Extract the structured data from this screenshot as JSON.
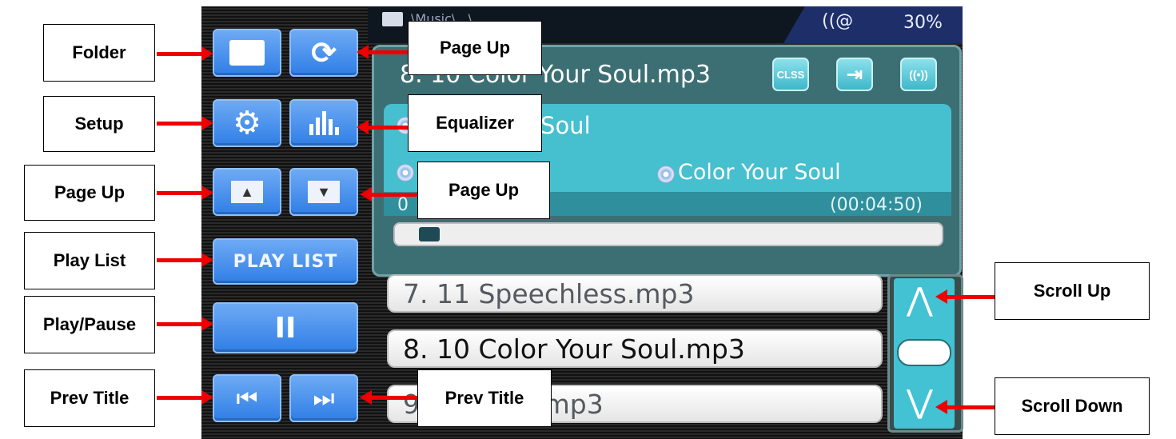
{
  "status": {
    "folder_path": "\\Music\\...\\",
    "signal_icon": "((@",
    "battery": "30%"
  },
  "sidebar": {
    "folder_icon": "folder-icon",
    "repeat_icon": "repeat-icon",
    "setup_icon": "gear-icon",
    "equalizer_icon": "equalizer-icon",
    "page_up_glyph": "▲",
    "page_down_glyph": "▼",
    "play_list_label": "PLAY LIST",
    "pause_glyph": "II",
    "prev_glyph": "⏮",
    "next_glyph": "⏭"
  },
  "now_playing": {
    "title": "8. 10 Color Your Soul.mp3",
    "buttons": [
      "CLSS",
      "⇥",
      "((•))"
    ],
    "song_line_1": "Color Your Soul",
    "song_line_2": "Color Your Soul",
    "time_elapsed": "0",
    "time_total": "(00:04:50)",
    "progress": 0.04
  },
  "playlist": [
    {
      "text": "7. 11 Speechless.mp3",
      "selected": false
    },
    {
      "text": "8. 10 Color Your Soul.mp3",
      "selected": true
    },
    {
      "text": "9. 12 Falls.mp3",
      "selected": false
    }
  ],
  "scroll": {
    "up_glyph": "⋀",
    "down_glyph": "⋁"
  },
  "callouts": {
    "folder": "Folder",
    "page_up_top": "Page Up",
    "setup": "Setup",
    "equalizer": "Equalizer",
    "page_up_left": "Page Up",
    "page_up_right": "Page Up",
    "play_list": "Play List",
    "play_pause": "Play/Pause",
    "prev_title_left": "Prev Title",
    "prev_title_right": "Prev Title",
    "scroll_up": "Scroll Up",
    "scroll_down": "Scroll Down"
  },
  "colors": {
    "accent_blue": "#3f8cf0",
    "teal": "#46bfcf",
    "arrow_red": "#ee0000"
  }
}
